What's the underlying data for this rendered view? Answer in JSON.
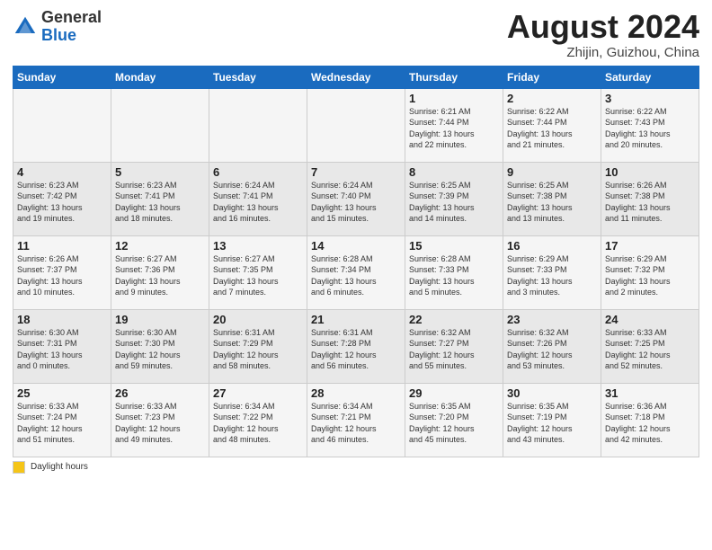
{
  "header": {
    "logo_general": "General",
    "logo_blue": "Blue",
    "month_year": "August 2024",
    "location": "Zhijin, Guizhou, China"
  },
  "days_of_week": [
    "Sunday",
    "Monday",
    "Tuesday",
    "Wednesday",
    "Thursday",
    "Friday",
    "Saturday"
  ],
  "weeks": [
    [
      {
        "day": "",
        "info": ""
      },
      {
        "day": "",
        "info": ""
      },
      {
        "day": "",
        "info": ""
      },
      {
        "day": "",
        "info": ""
      },
      {
        "day": "1",
        "info": "Sunrise: 6:21 AM\nSunset: 7:44 PM\nDaylight: 13 hours\nand 22 minutes."
      },
      {
        "day": "2",
        "info": "Sunrise: 6:22 AM\nSunset: 7:44 PM\nDaylight: 13 hours\nand 21 minutes."
      },
      {
        "day": "3",
        "info": "Sunrise: 6:22 AM\nSunset: 7:43 PM\nDaylight: 13 hours\nand 20 minutes."
      }
    ],
    [
      {
        "day": "4",
        "info": "Sunrise: 6:23 AM\nSunset: 7:42 PM\nDaylight: 13 hours\nand 19 minutes."
      },
      {
        "day": "5",
        "info": "Sunrise: 6:23 AM\nSunset: 7:41 PM\nDaylight: 13 hours\nand 18 minutes."
      },
      {
        "day": "6",
        "info": "Sunrise: 6:24 AM\nSunset: 7:41 PM\nDaylight: 13 hours\nand 16 minutes."
      },
      {
        "day": "7",
        "info": "Sunrise: 6:24 AM\nSunset: 7:40 PM\nDaylight: 13 hours\nand 15 minutes."
      },
      {
        "day": "8",
        "info": "Sunrise: 6:25 AM\nSunset: 7:39 PM\nDaylight: 13 hours\nand 14 minutes."
      },
      {
        "day": "9",
        "info": "Sunrise: 6:25 AM\nSunset: 7:38 PM\nDaylight: 13 hours\nand 13 minutes."
      },
      {
        "day": "10",
        "info": "Sunrise: 6:26 AM\nSunset: 7:38 PM\nDaylight: 13 hours\nand 11 minutes."
      }
    ],
    [
      {
        "day": "11",
        "info": "Sunrise: 6:26 AM\nSunset: 7:37 PM\nDaylight: 13 hours\nand 10 minutes."
      },
      {
        "day": "12",
        "info": "Sunrise: 6:27 AM\nSunset: 7:36 PM\nDaylight: 13 hours\nand 9 minutes."
      },
      {
        "day": "13",
        "info": "Sunrise: 6:27 AM\nSunset: 7:35 PM\nDaylight: 13 hours\nand 7 minutes."
      },
      {
        "day": "14",
        "info": "Sunrise: 6:28 AM\nSunset: 7:34 PM\nDaylight: 13 hours\nand 6 minutes."
      },
      {
        "day": "15",
        "info": "Sunrise: 6:28 AM\nSunset: 7:33 PM\nDaylight: 13 hours\nand 5 minutes."
      },
      {
        "day": "16",
        "info": "Sunrise: 6:29 AM\nSunset: 7:33 PM\nDaylight: 13 hours\nand 3 minutes."
      },
      {
        "day": "17",
        "info": "Sunrise: 6:29 AM\nSunset: 7:32 PM\nDaylight: 13 hours\nand 2 minutes."
      }
    ],
    [
      {
        "day": "18",
        "info": "Sunrise: 6:30 AM\nSunset: 7:31 PM\nDaylight: 13 hours\nand 0 minutes."
      },
      {
        "day": "19",
        "info": "Sunrise: 6:30 AM\nSunset: 7:30 PM\nDaylight: 12 hours\nand 59 minutes."
      },
      {
        "day": "20",
        "info": "Sunrise: 6:31 AM\nSunset: 7:29 PM\nDaylight: 12 hours\nand 58 minutes."
      },
      {
        "day": "21",
        "info": "Sunrise: 6:31 AM\nSunset: 7:28 PM\nDaylight: 12 hours\nand 56 minutes."
      },
      {
        "day": "22",
        "info": "Sunrise: 6:32 AM\nSunset: 7:27 PM\nDaylight: 12 hours\nand 55 minutes."
      },
      {
        "day": "23",
        "info": "Sunrise: 6:32 AM\nSunset: 7:26 PM\nDaylight: 12 hours\nand 53 minutes."
      },
      {
        "day": "24",
        "info": "Sunrise: 6:33 AM\nSunset: 7:25 PM\nDaylight: 12 hours\nand 52 minutes."
      }
    ],
    [
      {
        "day": "25",
        "info": "Sunrise: 6:33 AM\nSunset: 7:24 PM\nDaylight: 12 hours\nand 51 minutes."
      },
      {
        "day": "26",
        "info": "Sunrise: 6:33 AM\nSunset: 7:23 PM\nDaylight: 12 hours\nand 49 minutes."
      },
      {
        "day": "27",
        "info": "Sunrise: 6:34 AM\nSunset: 7:22 PM\nDaylight: 12 hours\nand 48 minutes."
      },
      {
        "day": "28",
        "info": "Sunrise: 6:34 AM\nSunset: 7:21 PM\nDaylight: 12 hours\nand 46 minutes."
      },
      {
        "day": "29",
        "info": "Sunrise: 6:35 AM\nSunset: 7:20 PM\nDaylight: 12 hours\nand 45 minutes."
      },
      {
        "day": "30",
        "info": "Sunrise: 6:35 AM\nSunset: 7:19 PM\nDaylight: 12 hours\nand 43 minutes."
      },
      {
        "day": "31",
        "info": "Sunrise: 6:36 AM\nSunset: 7:18 PM\nDaylight: 12 hours\nand 42 minutes."
      }
    ]
  ],
  "legend": {
    "label": "Daylight hours"
  }
}
